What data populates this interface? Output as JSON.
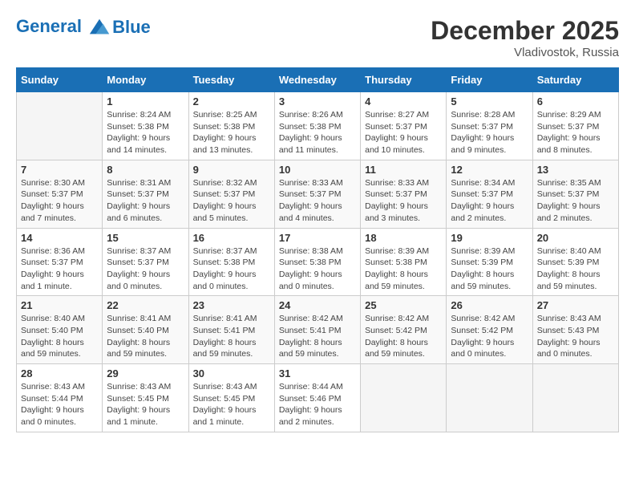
{
  "header": {
    "logo_line1": "General",
    "logo_line2": "Blue",
    "month_year": "December 2025",
    "location": "Vladivostok, Russia"
  },
  "weekdays": [
    "Sunday",
    "Monday",
    "Tuesday",
    "Wednesday",
    "Thursday",
    "Friday",
    "Saturday"
  ],
  "weeks": [
    [
      {
        "day": "",
        "sunrise": "",
        "sunset": "",
        "daylight": ""
      },
      {
        "day": "1",
        "sunrise": "Sunrise: 8:24 AM",
        "sunset": "Sunset: 5:38 PM",
        "daylight": "Daylight: 9 hours and 14 minutes."
      },
      {
        "day": "2",
        "sunrise": "Sunrise: 8:25 AM",
        "sunset": "Sunset: 5:38 PM",
        "daylight": "Daylight: 9 hours and 13 minutes."
      },
      {
        "day": "3",
        "sunrise": "Sunrise: 8:26 AM",
        "sunset": "Sunset: 5:38 PM",
        "daylight": "Daylight: 9 hours and 11 minutes."
      },
      {
        "day": "4",
        "sunrise": "Sunrise: 8:27 AM",
        "sunset": "Sunset: 5:37 PM",
        "daylight": "Daylight: 9 hours and 10 minutes."
      },
      {
        "day": "5",
        "sunrise": "Sunrise: 8:28 AM",
        "sunset": "Sunset: 5:37 PM",
        "daylight": "Daylight: 9 hours and 9 minutes."
      },
      {
        "day": "6",
        "sunrise": "Sunrise: 8:29 AM",
        "sunset": "Sunset: 5:37 PM",
        "daylight": "Daylight: 9 hours and 8 minutes."
      }
    ],
    [
      {
        "day": "7",
        "sunrise": "Sunrise: 8:30 AM",
        "sunset": "Sunset: 5:37 PM",
        "daylight": "Daylight: 9 hours and 7 minutes."
      },
      {
        "day": "8",
        "sunrise": "Sunrise: 8:31 AM",
        "sunset": "Sunset: 5:37 PM",
        "daylight": "Daylight: 9 hours and 6 minutes."
      },
      {
        "day": "9",
        "sunrise": "Sunrise: 8:32 AM",
        "sunset": "Sunset: 5:37 PM",
        "daylight": "Daylight: 9 hours and 5 minutes."
      },
      {
        "day": "10",
        "sunrise": "Sunrise: 8:33 AM",
        "sunset": "Sunset: 5:37 PM",
        "daylight": "Daylight: 9 hours and 4 minutes."
      },
      {
        "day": "11",
        "sunrise": "Sunrise: 8:33 AM",
        "sunset": "Sunset: 5:37 PM",
        "daylight": "Daylight: 9 hours and 3 minutes."
      },
      {
        "day": "12",
        "sunrise": "Sunrise: 8:34 AM",
        "sunset": "Sunset: 5:37 PM",
        "daylight": "Daylight: 9 hours and 2 minutes."
      },
      {
        "day": "13",
        "sunrise": "Sunrise: 8:35 AM",
        "sunset": "Sunset: 5:37 PM",
        "daylight": "Daylight: 9 hours and 2 minutes."
      }
    ],
    [
      {
        "day": "14",
        "sunrise": "Sunrise: 8:36 AM",
        "sunset": "Sunset: 5:37 PM",
        "daylight": "Daylight: 9 hours and 1 minute."
      },
      {
        "day": "15",
        "sunrise": "Sunrise: 8:37 AM",
        "sunset": "Sunset: 5:37 PM",
        "daylight": "Daylight: 9 hours and 0 minutes."
      },
      {
        "day": "16",
        "sunrise": "Sunrise: 8:37 AM",
        "sunset": "Sunset: 5:38 PM",
        "daylight": "Daylight: 9 hours and 0 minutes."
      },
      {
        "day": "17",
        "sunrise": "Sunrise: 8:38 AM",
        "sunset": "Sunset: 5:38 PM",
        "daylight": "Daylight: 9 hours and 0 minutes."
      },
      {
        "day": "18",
        "sunrise": "Sunrise: 8:39 AM",
        "sunset": "Sunset: 5:38 PM",
        "daylight": "Daylight: 8 hours and 59 minutes."
      },
      {
        "day": "19",
        "sunrise": "Sunrise: 8:39 AM",
        "sunset": "Sunset: 5:39 PM",
        "daylight": "Daylight: 8 hours and 59 minutes."
      },
      {
        "day": "20",
        "sunrise": "Sunrise: 8:40 AM",
        "sunset": "Sunset: 5:39 PM",
        "daylight": "Daylight: 8 hours and 59 minutes."
      }
    ],
    [
      {
        "day": "21",
        "sunrise": "Sunrise: 8:40 AM",
        "sunset": "Sunset: 5:40 PM",
        "daylight": "Daylight: 8 hours and 59 minutes."
      },
      {
        "day": "22",
        "sunrise": "Sunrise: 8:41 AM",
        "sunset": "Sunset: 5:40 PM",
        "daylight": "Daylight: 8 hours and 59 minutes."
      },
      {
        "day": "23",
        "sunrise": "Sunrise: 8:41 AM",
        "sunset": "Sunset: 5:41 PM",
        "daylight": "Daylight: 8 hours and 59 minutes."
      },
      {
        "day": "24",
        "sunrise": "Sunrise: 8:42 AM",
        "sunset": "Sunset: 5:41 PM",
        "daylight": "Daylight: 8 hours and 59 minutes."
      },
      {
        "day": "25",
        "sunrise": "Sunrise: 8:42 AM",
        "sunset": "Sunset: 5:42 PM",
        "daylight": "Daylight: 8 hours and 59 minutes."
      },
      {
        "day": "26",
        "sunrise": "Sunrise: 8:42 AM",
        "sunset": "Sunset: 5:42 PM",
        "daylight": "Daylight: 9 hours and 0 minutes."
      },
      {
        "day": "27",
        "sunrise": "Sunrise: 8:43 AM",
        "sunset": "Sunset: 5:43 PM",
        "daylight": "Daylight: 9 hours and 0 minutes."
      }
    ],
    [
      {
        "day": "28",
        "sunrise": "Sunrise: 8:43 AM",
        "sunset": "Sunset: 5:44 PM",
        "daylight": "Daylight: 9 hours and 0 minutes."
      },
      {
        "day": "29",
        "sunrise": "Sunrise: 8:43 AM",
        "sunset": "Sunset: 5:45 PM",
        "daylight": "Daylight: 9 hours and 1 minute."
      },
      {
        "day": "30",
        "sunrise": "Sunrise: 8:43 AM",
        "sunset": "Sunset: 5:45 PM",
        "daylight": "Daylight: 9 hours and 1 minute."
      },
      {
        "day": "31",
        "sunrise": "Sunrise: 8:44 AM",
        "sunset": "Sunset: 5:46 PM",
        "daylight": "Daylight: 9 hours and 2 minutes."
      },
      {
        "day": "",
        "sunrise": "",
        "sunset": "",
        "daylight": ""
      },
      {
        "day": "",
        "sunrise": "",
        "sunset": "",
        "daylight": ""
      },
      {
        "day": "",
        "sunrise": "",
        "sunset": "",
        "daylight": ""
      }
    ]
  ]
}
